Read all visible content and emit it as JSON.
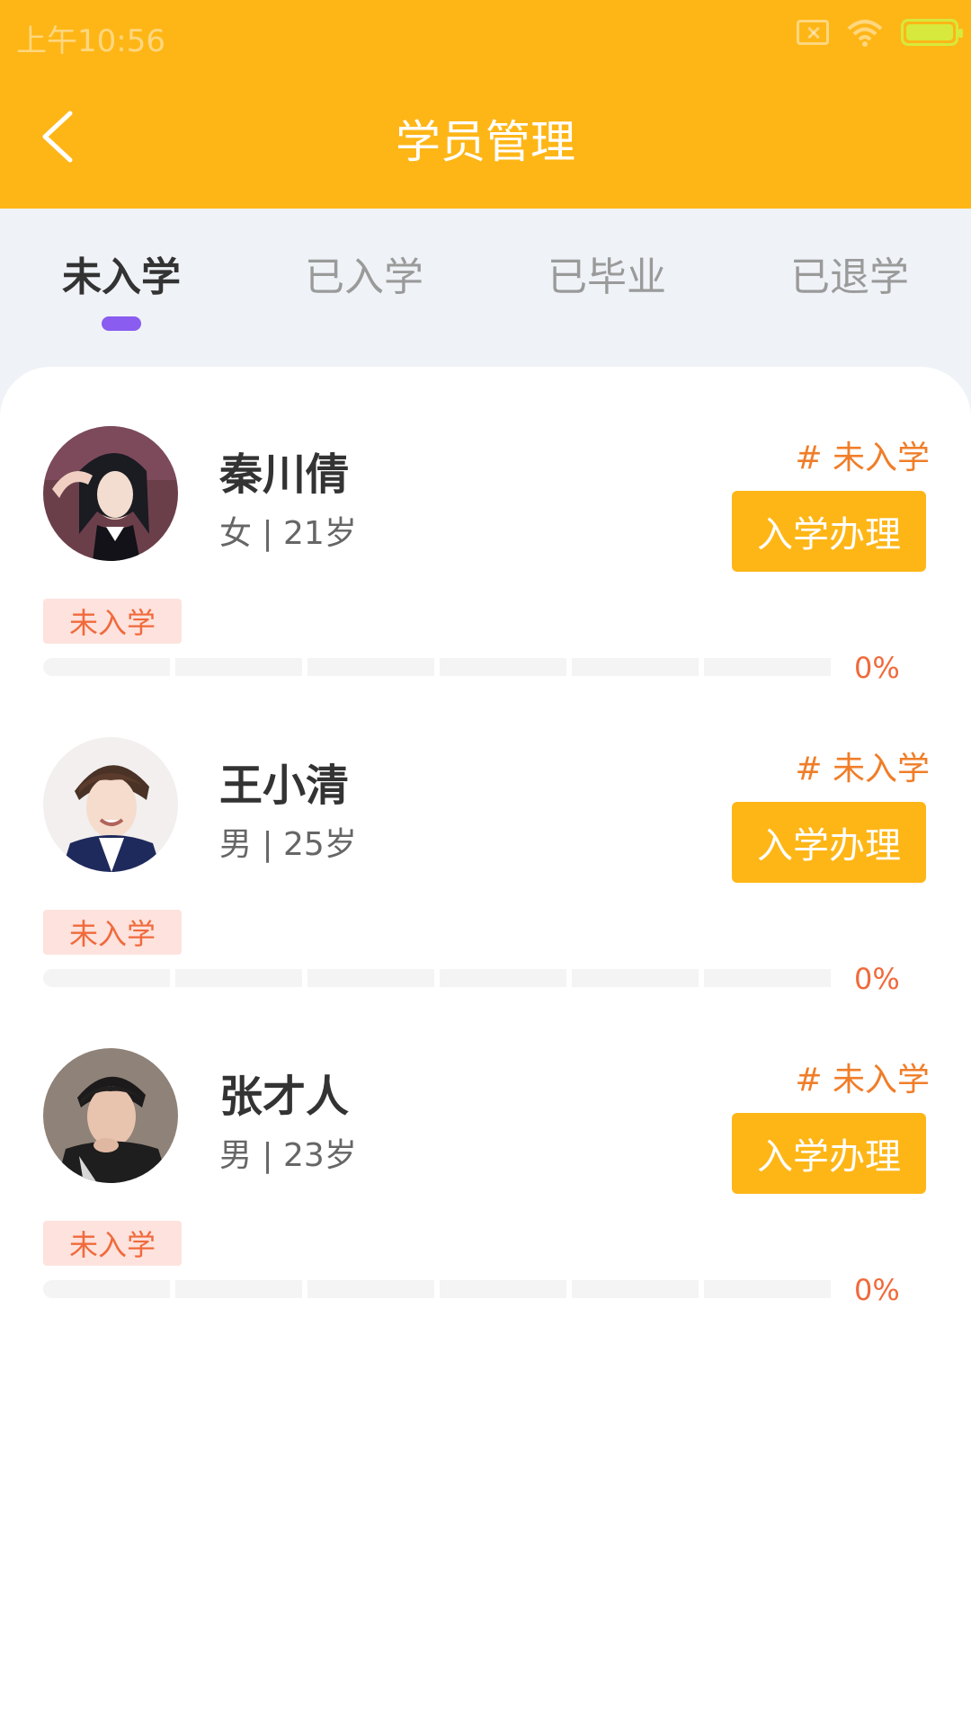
{
  "status_bar": {
    "time": "上午10:56",
    "icons": [
      "sim-card-icon",
      "wifi-icon",
      "battery-charging-icon"
    ]
  },
  "header": {
    "title": "学员管理",
    "back_icon": "chevron-left-icon"
  },
  "colors": {
    "accent": "#feb617",
    "tab_indicator": "#8a5cf0",
    "status_orange": "#f07d28",
    "badge_bg": "#fde2dd"
  },
  "tabs": [
    {
      "label": "未入学",
      "active": true
    },
    {
      "label": "已入学",
      "active": false
    },
    {
      "label": "已毕业",
      "active": false
    },
    {
      "label": "已退学",
      "active": false
    }
  ],
  "students": [
    {
      "name": "秦川倩",
      "meta": "女 | 21岁",
      "status_tag": "# 未入学",
      "button": "入学办理",
      "badge": "未入学",
      "progress": 0,
      "progress_label": "0%"
    },
    {
      "name": "王小清",
      "meta": "男 | 25岁",
      "status_tag": "# 未入学",
      "button": "入学办理",
      "badge": "未入学",
      "progress": 0,
      "progress_label": "0%"
    },
    {
      "name": "张才人",
      "meta": "男 | 23岁",
      "status_tag": "# 未入学",
      "button": "入学办理",
      "badge": "未入学",
      "progress": 0,
      "progress_label": "0%"
    }
  ]
}
